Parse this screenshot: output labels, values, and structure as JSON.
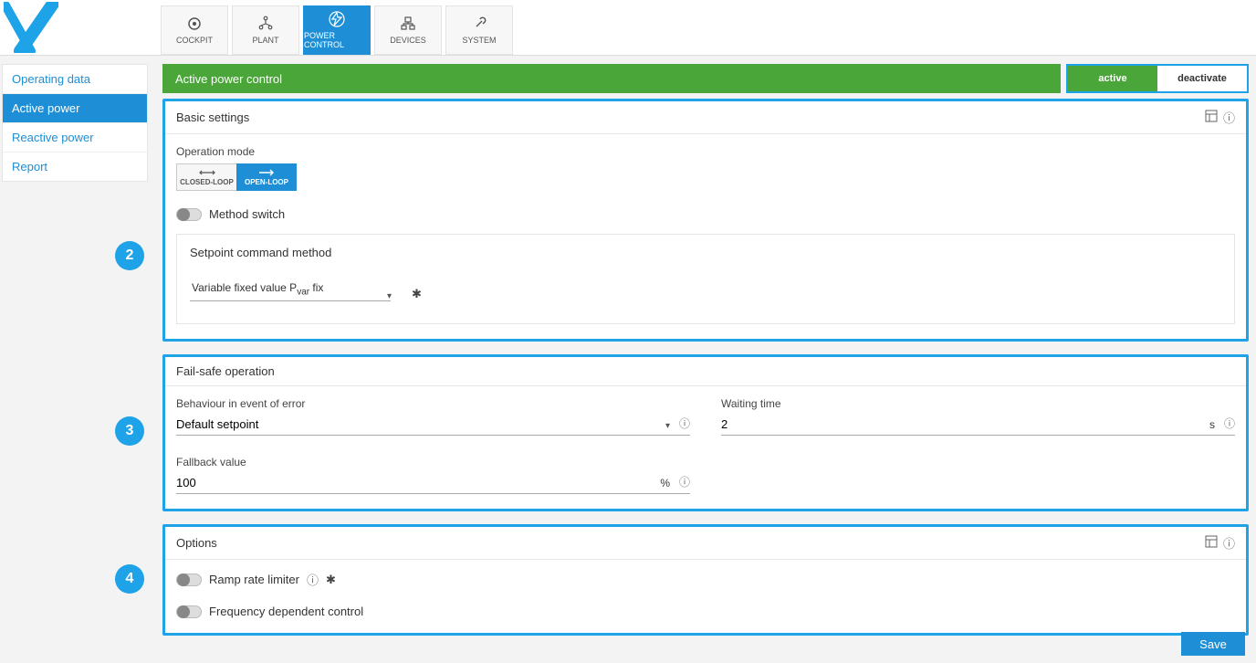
{
  "tabs": [
    {
      "label": "COCKPIT"
    },
    {
      "label": "PLANT"
    },
    {
      "label": "POWER CONTROL"
    },
    {
      "label": "DEVICES"
    },
    {
      "label": "SYSTEM"
    }
  ],
  "sidenav": [
    {
      "label": "Operating data"
    },
    {
      "label": "Active power"
    },
    {
      "label": "Reactive power"
    },
    {
      "label": "Report"
    }
  ],
  "page_title": "Active power control",
  "activation": {
    "on": "active",
    "off": "deactivate"
  },
  "basic": {
    "title": "Basic settings",
    "op_mode_label": "Operation mode",
    "closed_loop": "CLOSED-LOOP",
    "open_loop": "OPEN-LOOP",
    "method_switch": "Method switch",
    "setpoint_title": "Setpoint command method",
    "setpoint_value_prefix": "Variable fixed value P",
    "setpoint_value_sub": "var",
    "setpoint_value_suffix": " fix"
  },
  "failsafe": {
    "title": "Fail-safe operation",
    "behaviour_label": "Behaviour in event of error",
    "behaviour_value": "Default setpoint",
    "waiting_label": "Waiting time",
    "waiting_value": "2",
    "waiting_unit": "s",
    "fallback_label": "Fallback value",
    "fallback_value": "100",
    "fallback_unit": "%"
  },
  "options": {
    "title": "Options",
    "ramp": "Ramp rate limiter",
    "freq": "Frequency dependent control"
  },
  "save": "Save"
}
